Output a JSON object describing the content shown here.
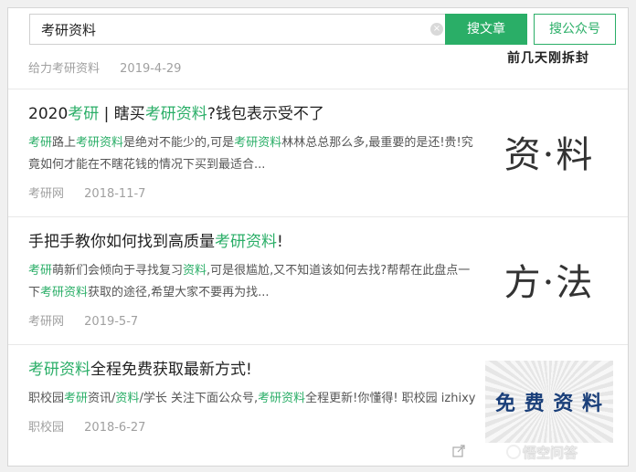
{
  "search": {
    "value": "考研资料",
    "clear": "×",
    "article_button": "搜文章",
    "account_button": "搜公众号"
  },
  "top_result": {
    "source": "给力考研资料",
    "date": "2019-4-29",
    "thumb_text": "前几天刚拆封"
  },
  "results": [
    {
      "title_parts": [
        "2020",
        "考研",
        " | 瞎买",
        "考研资料",
        "?钱包表示受不了"
      ],
      "desc_parts": [
        "考研",
        "路上",
        "考研资料",
        "是绝对不能少的,可是",
        "考研资料",
        "林林总总那么多,最重要的是还!贵!究竟如何才能在不瞎花钱的情况下买到最适合..."
      ],
      "source": "考研网",
      "date": "2018-11-7",
      "thumb_text": "资·料"
    },
    {
      "title_parts": [
        "手把手教你如何找到高质量",
        "考研资料",
        "!"
      ],
      "desc_parts": [
        "考研",
        "萌新们会倾向于寻找复习",
        "资料",
        ",可是很尴尬,又不知道该如何去找?帮帮在此盘点一下",
        "考研资料",
        "获取的途径,希望大家不要再为找..."
      ],
      "source": "考研网",
      "date": "2019-5-7",
      "thumb_text": "方·法"
    },
    {
      "title_parts": [
        "考研资料",
        "全程免费获取最新方式!"
      ],
      "desc_parts": [
        "职校园",
        "考研",
        "资讯/",
        "资料",
        "/学长 关注下面公众号,",
        "考研资料",
        "全程更新!你懂得! 职校园 izhixy"
      ],
      "source": "职校园",
      "date": "2018-6-27",
      "thumb_text": "免 费 资 料"
    }
  ],
  "watermark": "悟空问答"
}
